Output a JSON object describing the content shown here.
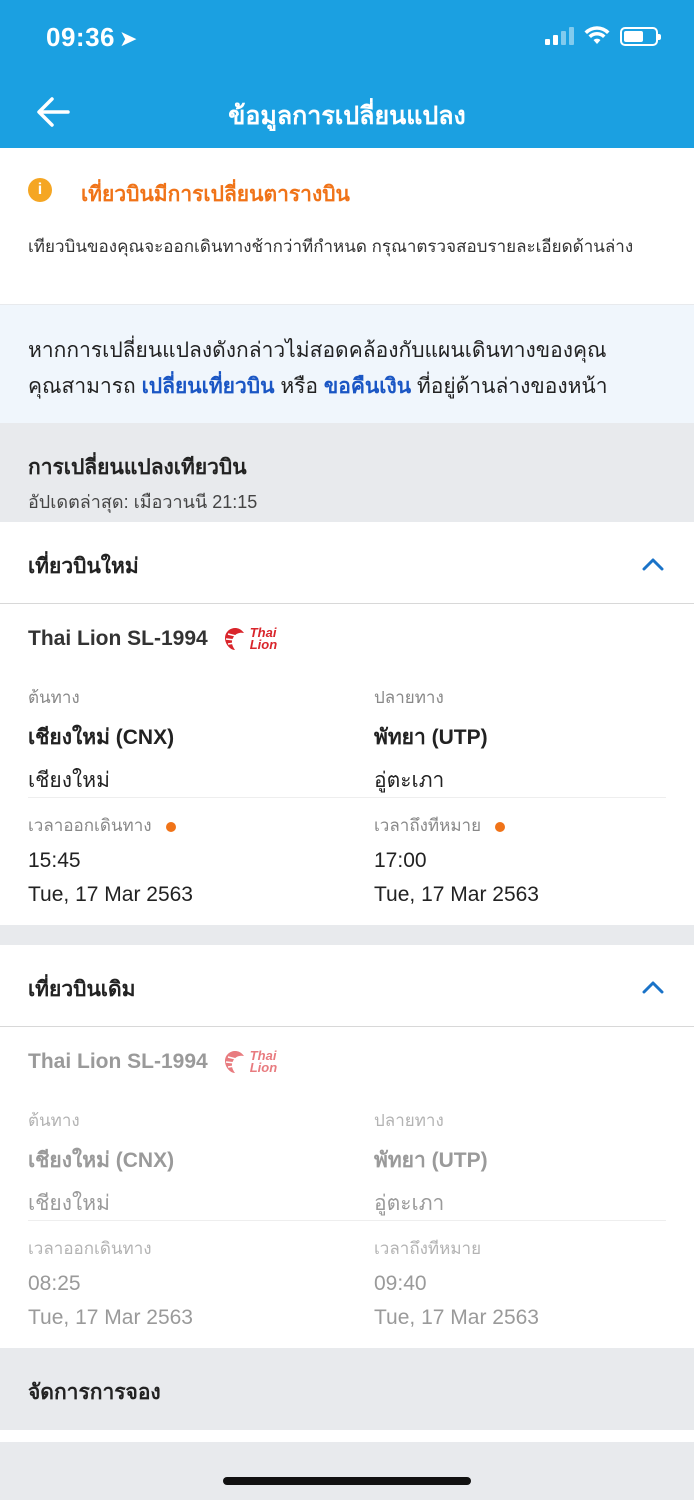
{
  "status_bar": {
    "time": "09:36"
  },
  "header": {
    "title": "ข้อมูลการเปลี่ยนแปลง"
  },
  "alert": {
    "icon": "i",
    "title": "เที่ยวบินมีการเปลี่ยนตารางบิน",
    "text": "เทียวบินของคุณจะออกเดินทางช้ากว่าทีกำหนด กรุณาตรวจสอบรายละเอียดด้านล่าง"
  },
  "info": {
    "line1": "หากการเปลี่ยนแปลงดังกล่าวไม่สอดคล้องกับแผนเดินทางของคุณ",
    "prefix": "คุณสามารถ",
    "link_change": "เปลี่ยนเที่ยวบิน",
    "or": "หรือ",
    "link_refund": "ขอคืนเงิน",
    "suffix": "ที่อยู่ด้านล่างของหน้า"
  },
  "section": {
    "title": "การเปลี่ยนแปลงเทียวบิน",
    "updated": "อัปเดตล่าสุด: เมือวานนี 21:15"
  },
  "new_flight": {
    "heading": "เที่ยวบินใหม่",
    "flight": "Thai Lion SL-1994",
    "logo_line1": "Thai",
    "logo_line2": "Lion",
    "origin_label": "ต้นทาง",
    "origin": "เชียงใหม่ (CNX)",
    "origin_city": "เชียงใหม่",
    "dest_label": "ปลายทาง",
    "dest": "พัทยา (UTP)",
    "dest_city": "อู่ตะเภา",
    "dep_label": "เวลาออกเดินทาง",
    "dep_time": "15:45",
    "dep_date": "Tue, 17 Mar 2563",
    "arr_label": "เวลาถึงทีหมาย",
    "arr_time": "17:00",
    "arr_date": "Tue, 17 Mar 2563"
  },
  "old_flight": {
    "heading": "เที่ยวบินเดิม",
    "flight": "Thai Lion SL-1994",
    "logo_line1": "Thai",
    "logo_line2": "Lion",
    "origin_label": "ต้นทาง",
    "origin": "เชียงใหม่ (CNX)",
    "origin_city": "เชียงใหม่",
    "dest_label": "ปลายทาง",
    "dest": "พัทยา (UTP)",
    "dest_city": "อู่ตะเภา",
    "dep_label": "เวลาออกเดินทาง",
    "dep_time": "08:25",
    "dep_date": "Tue, 17 Mar 2563",
    "arr_label": "เวลาถึงทีหมาย",
    "arr_time": "09:40",
    "arr_date": "Tue, 17 Mar 2563"
  },
  "manage": {
    "title": "จัดการการจอง"
  },
  "colors": {
    "header": "#1ba0e1",
    "alert": "#f07318",
    "link": "#1a56c4",
    "chevron": "#1a73c8"
  }
}
